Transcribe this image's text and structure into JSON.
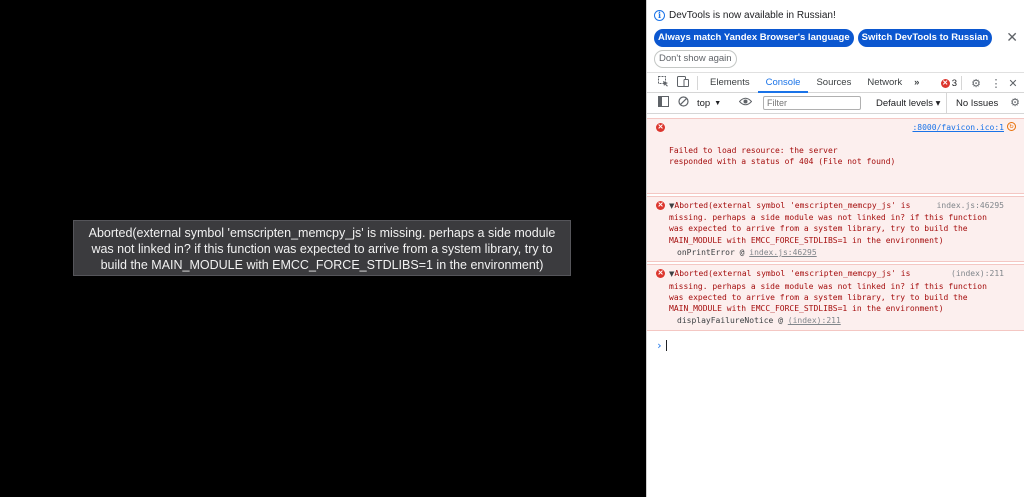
{
  "page": {
    "error_overlay_text": "Aborted(external symbol 'emscripten_memcpy_js' is missing. perhaps a side module was not linked in? if this function was expected to arrive from a system library, try to build the MAIN_MODULE with EMCC_FORCE_STDLIBS=1 in the environment)"
  },
  "devtools": {
    "infobar": {
      "message": "DevTools is now available in Russian!",
      "button_match": "Always match Yandex Browser's language",
      "button_switch": "Switch DevTools to Russian",
      "button_dismiss": "Don't show again",
      "close_glyph": "✕"
    },
    "tabs": {
      "elements": "Elements",
      "console": "Console",
      "sources": "Sources",
      "network": "Network",
      "more": "»",
      "error_count": "3"
    },
    "console_toolbar": {
      "context": "top",
      "filter_placeholder": "Filter",
      "levels": "Default levels ▾",
      "issues": "No Issues"
    },
    "messages": [
      {
        "text": "Failed to load resource: the server\nresponded with a status of 404 (File not found)",
        "source": ":8000/favicon.ico:1"
      },
      {
        "text": "Aborted(external symbol 'emscripten_memcpy_js' is\nmissing. perhaps a side module was not linked in? if this function\nwas expected to arrive from a system library, try to build the\nMAIN_MODULE with EMCC_FORCE_STDLIBS=1 in the environment)",
        "source": "index.js:46295",
        "stack_fn": "onPrintError @ ",
        "stack_link": "index.js:46295"
      },
      {
        "text": "Aborted(external symbol 'emscripten_memcpy_js' is\nmissing. perhaps a side module was not linked in? if this function\nwas expected to arrive from a system library, try to build the\nMAIN_MODULE with EMCC_FORCE_STDLIBS=1 in the environment)",
        "source": "(index):211",
        "stack_fn": "displayFailureNotice @ ",
        "stack_link": "(index):211"
      }
    ],
    "prompt": "›"
  }
}
